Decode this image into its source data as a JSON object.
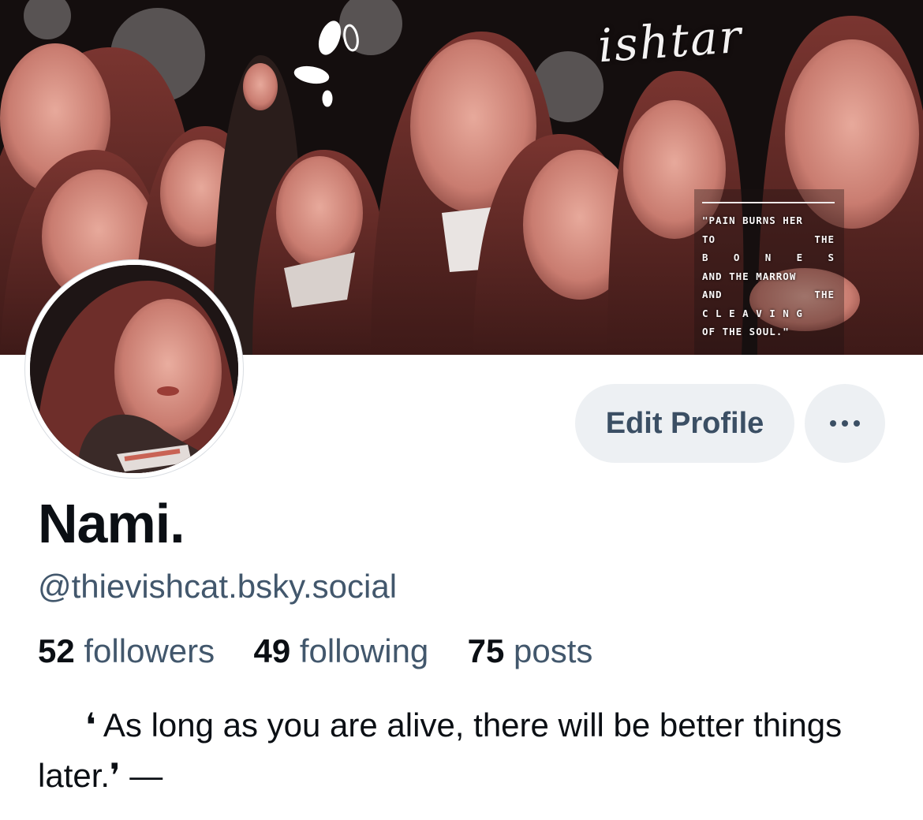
{
  "banner": {
    "script_text": "ishtar",
    "quote_lines": [
      [
        "\"PAIN BURNS HER"
      ],
      [
        "TO",
        "THE"
      ],
      [
        "B",
        "O",
        "N",
        "E",
        "S"
      ],
      [
        "AND THE MARROW"
      ],
      [
        "AND",
        "THE"
      ],
      [
        "C L E A V I N G"
      ],
      [
        "OF THE SOUL.\""
      ]
    ]
  },
  "profile": {
    "display_name": "Nami.",
    "handle": "@thievishcat.bsky.social",
    "bio": "❛ As long as you are alive, there will be better things later.❜ —"
  },
  "actions": {
    "edit_label": "Edit Profile",
    "more_icon": "ellipsis-icon"
  },
  "stats": {
    "followers_count": "52",
    "followers_label": "followers",
    "following_count": "49",
    "following_label": "following",
    "posts_count": "75",
    "posts_label": "posts"
  },
  "colors": {
    "accent_text": "#42576c",
    "button_bg": "#edf0f3",
    "button_text": "#3b4f64",
    "primary_text": "#0b0f14"
  }
}
